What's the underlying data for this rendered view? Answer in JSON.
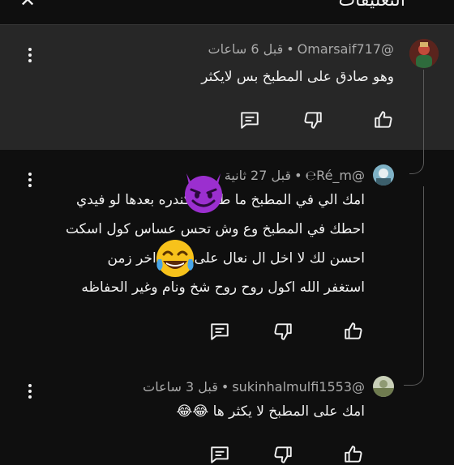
{
  "header": {
    "title": "التعليقات",
    "close_icon": "close-icon"
  },
  "parent_comment": {
    "handle": "@Omarsaif717",
    "time": "قبل 6 ساعات",
    "text": "وهو صادق على المطبخ بس لايكثر"
  },
  "replies": [
    {
      "handle": "@Ré_m℮",
      "time": "قبل 27 ثانية",
      "lines": [
        "امك الي في المطبخ ما طلعت كندره بعدها لو فيدي",
        "احطك في المطبخ وع وش تحس عساس كول اسكت",
        "احسن لك لا اخل ال نعال على جهال اخر زمن",
        "استغفر الله  اكول روح روح شخ ونام وغير الحفاظه"
      ]
    },
    {
      "handle": "@sukinhalmulfi1553",
      "time": "قبل 3 ساعات",
      "text": "امك على المطبخ لا يكثر ها 😂😂"
    }
  ],
  "stickers": [
    "smiling-devil-emoji",
    "laughing-tears-emoji"
  ],
  "colors": {
    "background": "#0f0f0f",
    "highlight": "#272727",
    "meta": "#aaaaaa",
    "text": "#f1f1f1"
  }
}
